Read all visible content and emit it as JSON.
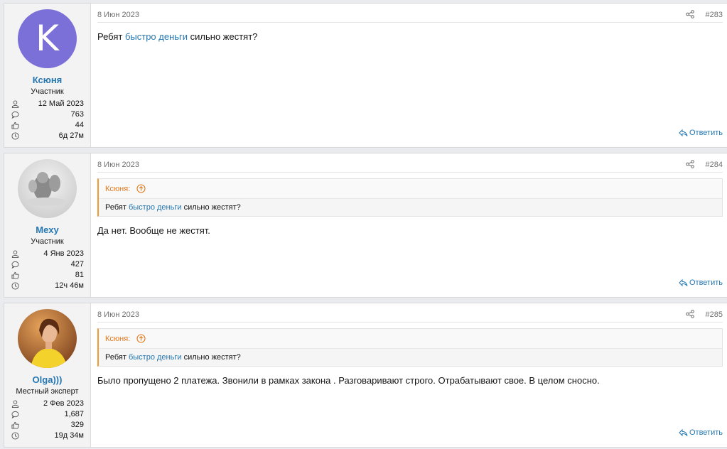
{
  "posts": [
    {
      "author": "Ксюня",
      "avatar_letter": "K",
      "user_title": "Участник",
      "stats": {
        "joined": "12 Май 2023",
        "messages": "763",
        "reactions": "44",
        "online": "6д 27м"
      },
      "date": "8 Июн 2023",
      "number": "#283",
      "body": {
        "before": "Ребят ",
        "link": "быстро деньги",
        "after": " сильно жестят?"
      },
      "reply_label": "Ответить"
    },
    {
      "author": "Mexy",
      "user_title": "Участник",
      "stats": {
        "joined": "4 Янв 2023",
        "messages": "427",
        "reactions": "81",
        "online": "12ч 46м"
      },
      "date": "8 Июн 2023",
      "number": "#284",
      "quote": {
        "author": "Ксюня:",
        "before": "Ребят ",
        "link": "быстро деньги",
        "after": " сильно жестят?"
      },
      "body_text": "Да нет. Вообще не жестят.",
      "reply_label": "Ответить"
    },
    {
      "author": "Olga)))",
      "user_title": "Местный эксперт",
      "stats": {
        "joined": "2 Фев 2023",
        "messages": "1,687",
        "reactions": "329",
        "online": "19д 34м"
      },
      "date": "8 Июн 2023",
      "number": "#285",
      "quote": {
        "author": "Ксюня:",
        "before": "Ребят ",
        "link": "быстро деньги",
        "after": " сильно жестят?"
      },
      "body_text": "Было пропущено 2 платежа. Звонили в рамках закона . Разговаривают строго. Отрабатывают свое. В целом сносно.",
      "reply_label": "Ответить"
    }
  ],
  "icons": {
    "joined": "user-icon",
    "messages": "comment-icon",
    "reactions": "thumbs-up-icon",
    "online": "clock-icon",
    "share": "share-icon",
    "quote_jump": "arrow-up-circle-icon",
    "reply": "reply-icon"
  },
  "colors": {
    "accent": "#2577b1",
    "quote_author": "#e27a1c",
    "quote_border": "#f19b2c",
    "avatar_letter_bg": "#7b6fd8"
  }
}
